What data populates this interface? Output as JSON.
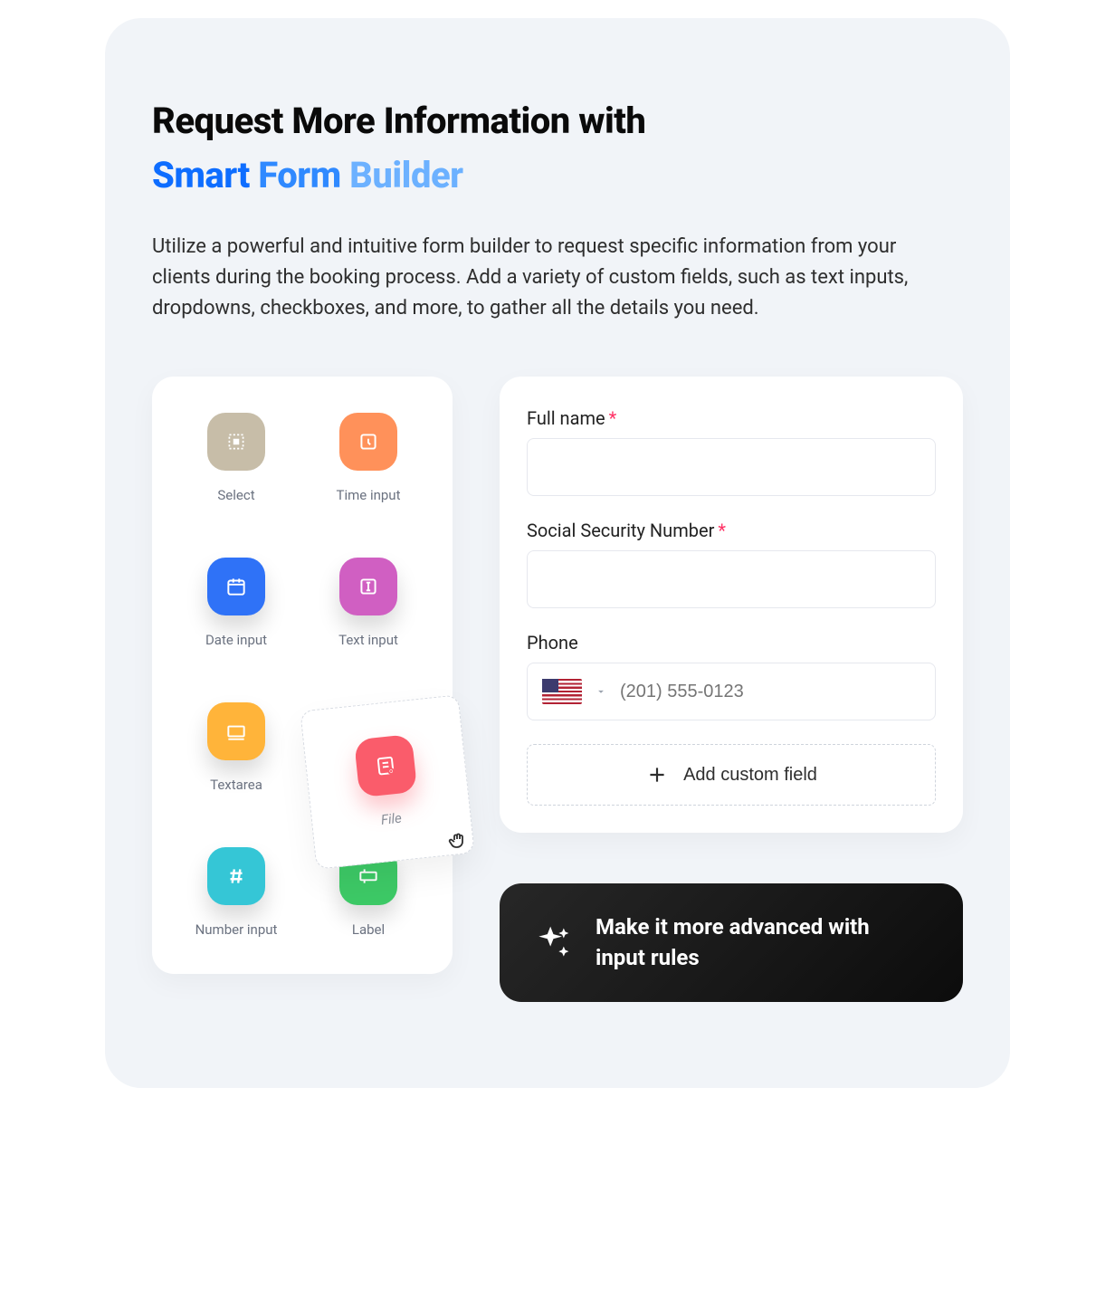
{
  "heading": {
    "line1": "Request More Information with",
    "sub1": "Smart",
    "sub2": "Form",
    "sub3": "Builder"
  },
  "description": "Utilize a powerful and intuitive form builder to request specific information from your clients during the booking process. Add a variety of custom fields, such as text inputs, dropdowns, checkboxes, and more, to gather all the details you need.",
  "palette": {
    "select": "Select",
    "time_input": "Time input",
    "date_input": "Date input",
    "text_input": "Text input",
    "textarea": "Textarea",
    "number_input": "Number input",
    "label": "Label",
    "file": "File"
  },
  "colors": {
    "select": "#c7bda8",
    "time_input": "#ff915a",
    "date_input": "#2f72f7",
    "text_input": "#d05fc2",
    "textarea": "#ffb43a",
    "number_input": "#35c6d6",
    "label": "#3dc966",
    "file": "#fa5c6b"
  },
  "form": {
    "fullname_label": "Full name",
    "ssn_label": "Social Security Number",
    "phone_label": "Phone",
    "phone_placeholder": "(201) 555-0123",
    "add_custom": "Add custom field"
  },
  "cta": {
    "text": "Make it more advanced with input rules"
  }
}
